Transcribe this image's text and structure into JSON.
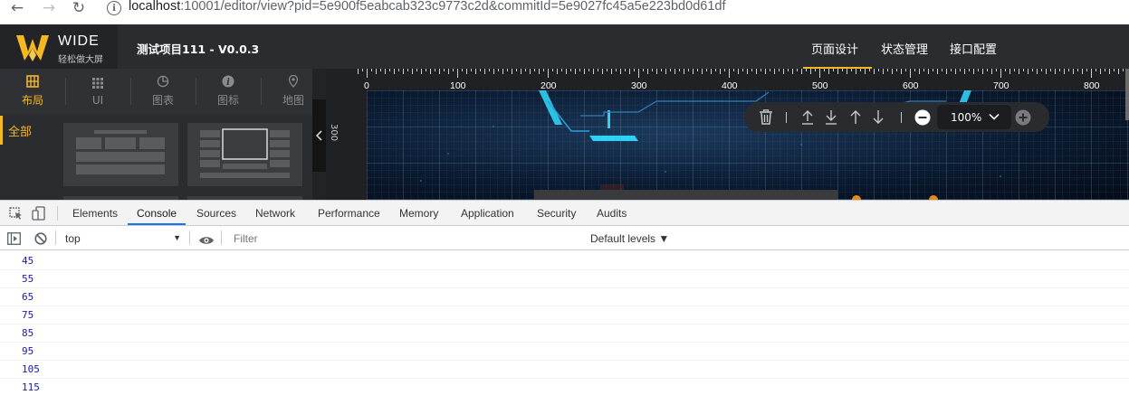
{
  "browser": {
    "url_host": "localhost",
    "url_rest": ":10001/editor/view?pid=5e900f5eabcab323c9773c2d&commitId=5e9027fc45a5e223bd0d61df",
    "icons": [
      "back-icon",
      "forward-icon",
      "reload-icon",
      "site-info-icon"
    ]
  },
  "app": {
    "brand": "WIDE",
    "brand_sub": "轻松做大屏",
    "project_title": "测试项目111 - V0.0.3",
    "top_tabs": [
      {
        "label": "页面设计",
        "active": true
      },
      {
        "label": "状态管理",
        "active": false
      },
      {
        "label": "接口配置",
        "active": false
      }
    ],
    "left_tabs": [
      {
        "label": "布局",
        "icon": "layout-icon",
        "active": true
      },
      {
        "label": "UI",
        "icon": "grid-dots-icon",
        "active": false
      },
      {
        "label": "图表",
        "icon": "chart-pie-icon",
        "active": false
      },
      {
        "label": "图标",
        "icon": "info-icon",
        "active": false
      },
      {
        "label": "地图",
        "icon": "map-pin-icon",
        "active": false
      }
    ],
    "category_selected": "全部",
    "accent_color": "#f4b820",
    "ruler": {
      "h_labels": [
        "0",
        "100",
        "200",
        "300",
        "400",
        "500",
        "600",
        "700",
        "800"
      ],
      "v_label": "300"
    },
    "toolbar": {
      "zoom": "100%",
      "icons": [
        "trash-icon",
        "bring-to-top-icon",
        "send-to-bottom-icon",
        "move-up-icon",
        "move-down-icon",
        "zoom-out-icon",
        "chevron-down-icon",
        "zoom-in-icon"
      ]
    }
  },
  "devtools": {
    "tabs": [
      {
        "label": "Elements",
        "active": false
      },
      {
        "label": "Console",
        "active": true
      },
      {
        "label": "Sources",
        "active": false
      },
      {
        "label": "Network",
        "active": false
      },
      {
        "label": "Performance",
        "active": false
      },
      {
        "label": "Memory",
        "active": false
      },
      {
        "label": "Application",
        "active": false
      },
      {
        "label": "Security",
        "active": false
      },
      {
        "label": "Audits",
        "active": false
      }
    ],
    "context": "top",
    "filter_placeholder": "Filter",
    "levels": "Default levels ▼",
    "log_values": [
      "45",
      "55",
      "65",
      "75",
      "85",
      "95",
      "105",
      "115"
    ]
  }
}
